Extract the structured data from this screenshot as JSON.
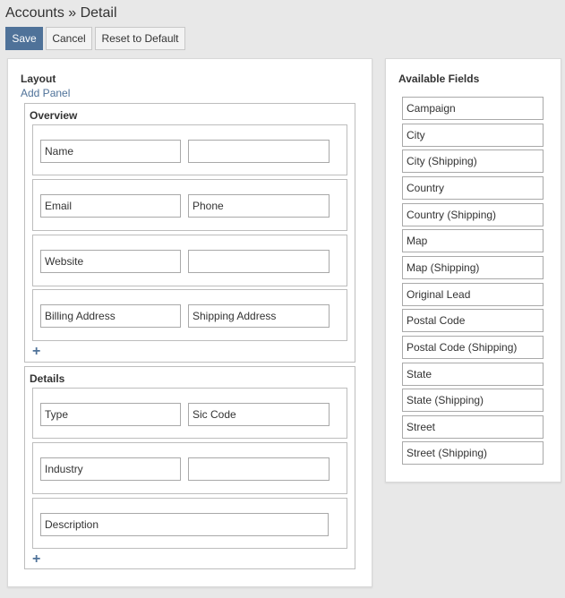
{
  "page": {
    "title": "Accounts » Detail"
  },
  "toolbar": {
    "save": "Save",
    "cancel": "Cancel",
    "reset": "Reset to Default"
  },
  "layout": {
    "heading": "Layout",
    "add_panel": "Add Panel",
    "panels": [
      {
        "title": "Overview",
        "add_row_icon": "plus-icon",
        "rows": [
          [
            "Name",
            ""
          ],
          [
            "Email",
            "Phone"
          ],
          [
            "Website",
            ""
          ],
          [
            "Billing Address",
            "Shipping Address"
          ]
        ]
      },
      {
        "title": "Details",
        "add_row_icon": "plus-icon",
        "rows": [
          [
            "Type",
            "Sic Code"
          ],
          [
            "Industry",
            ""
          ],
          [
            "Description"
          ]
        ]
      }
    ]
  },
  "available_fields": {
    "heading": "Available Fields",
    "items": [
      "Campaign",
      "City",
      "City (Shipping)",
      "Country",
      "Country (Shipping)",
      "Map",
      "Map (Shipping)",
      "Original Lead",
      "Postal Code",
      "Postal Code (Shipping)",
      "State",
      "State (Shipping)",
      "Street",
      "Street (Shipping)"
    ]
  },
  "colors": {
    "primary": "#4f7299",
    "link": "#4f7299",
    "background": "#e8e8e8"
  }
}
